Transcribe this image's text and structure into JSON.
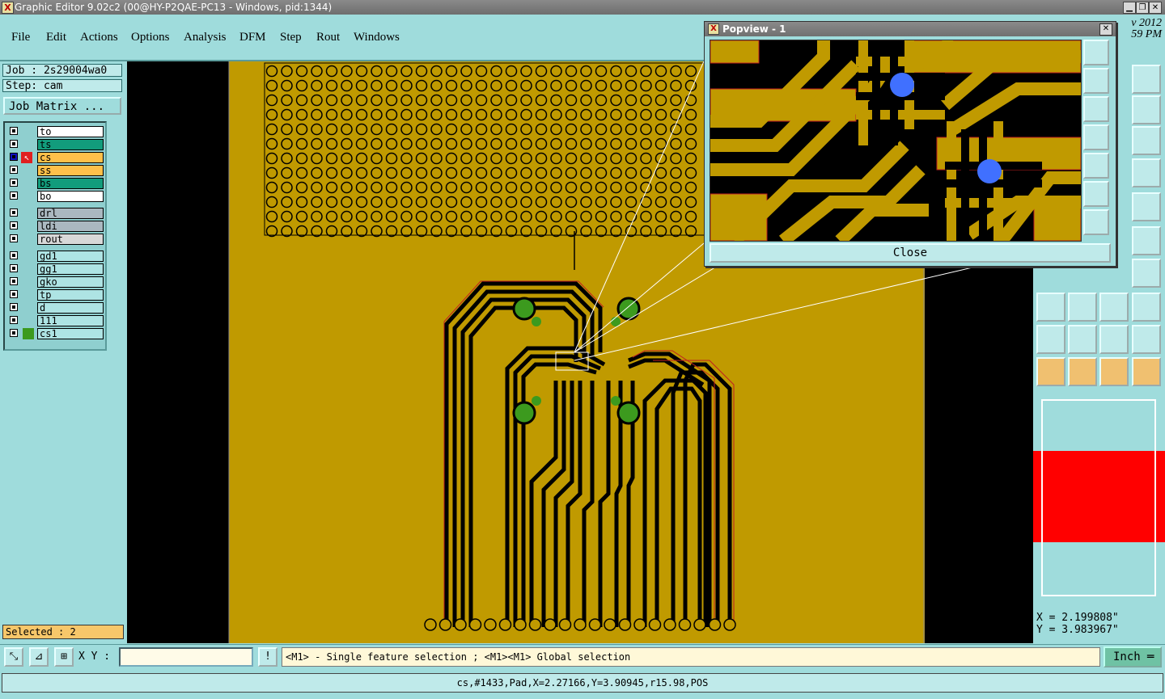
{
  "window": {
    "title": "Graphic Editor 9.02c2 (00@HY-P2QAE-PC13 - Windows, pid:1344)"
  },
  "menu": [
    "File",
    "Edit",
    "Actions",
    "Options",
    "Analysis",
    "DFM",
    "Step",
    "Rout",
    "Windows"
  ],
  "job": {
    "label": "Job : 2s29004wa0",
    "step": "Step: cam",
    "matrix_button": "Job Matrix ..."
  },
  "layers": [
    {
      "name": "to",
      "color": "#ffffff"
    },
    {
      "name": "ts",
      "color": "#129c7c"
    },
    {
      "name": "cs",
      "color": "#ffc04a",
      "active": true
    },
    {
      "name": "ss",
      "color": "#ffc04a"
    },
    {
      "name": "bs",
      "color": "#129c7c"
    },
    {
      "name": "bo",
      "color": "#ffffff"
    },
    {
      "name": "drl",
      "color": "#aab8c0"
    },
    {
      "name": "ldi",
      "color": "#aab8c0"
    },
    {
      "name": "rout",
      "color": "#d8d8d8"
    },
    {
      "name": "gd1",
      "color": "#aee4e4"
    },
    {
      "name": "gg1",
      "color": "#aee4e4"
    },
    {
      "name": "gko",
      "color": "#aee4e4"
    },
    {
      "name": "tp",
      "color": "#aee4e4"
    },
    {
      "name": "d",
      "color": "#aee4e4"
    },
    {
      "name": "111",
      "color": "#aee4e4"
    },
    {
      "name": "cs1",
      "color": "#aee4e4"
    }
  ],
  "selection": {
    "text": "Selected : 2"
  },
  "xy": {
    "label": "X Y :",
    "value": ""
  },
  "message": "<M1> - Single feature selection ; <M1><M1> Global selection",
  "units": "Inch",
  "status": "cs,#1433,Pad,X=2.27166,Y=3.90945,r15.98,POS",
  "date": {
    "line1": "v 2012",
    "line2": "59 PM"
  },
  "cursor": {
    "x": "X = 2.199808\"",
    "y": "Y = 3.983967\""
  },
  "popview": {
    "title": "Popview - 1",
    "close_label": "Close"
  },
  "colors": {
    "copper": "#c09a00",
    "background": "#000000",
    "panel": "#9fdcdc",
    "pad_green": "#3c9a1e",
    "pad_blue": "#4070ff"
  }
}
